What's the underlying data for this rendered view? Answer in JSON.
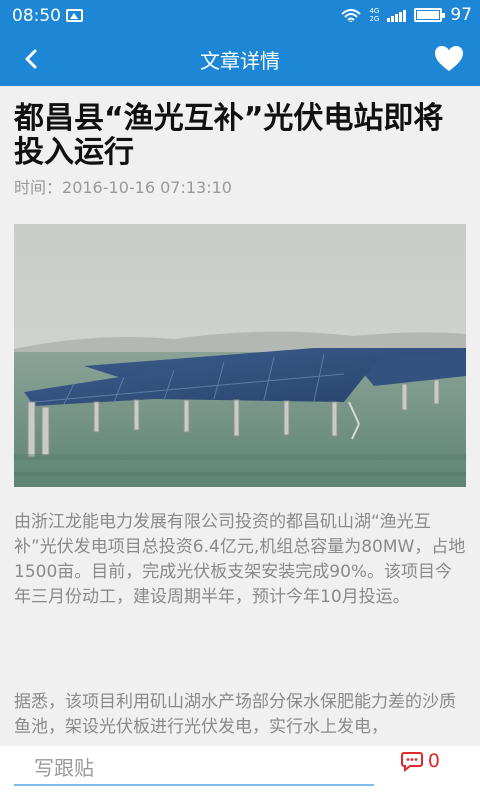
{
  "status_bar": {
    "time": "08:50",
    "network_top": "4G",
    "network_bottom": "2G",
    "battery": "97"
  },
  "header": {
    "title": "文章详情"
  },
  "article": {
    "title": "都昌县“渔光互补”光伏电站即将投入运行",
    "time_label": "时间：",
    "time_value": "2016-10-16 07:13:10",
    "paragraphs": [
      "由浙江龙能电力发展有限公司投资的都昌矶山湖“渔光互补”光伏发电项目总投资6.4亿元,机组总容量为80MW，占地1500亩。目前，完成光伏板支架安装完成90%。该项目今年三月份动工，建设周期半年，预计今年10月投运。",
      "据悉，该项目利用矶山湖水产场部分保水保肥能力差的沙质鱼池，架设光伏板进行光伏发电，实行水上发电，"
    ]
  },
  "bottom_bar": {
    "reply_placeholder": "写跟贴",
    "comment_count": "0"
  },
  "colors": {
    "brand_blue": "#1d87d6",
    "comment_red": "#e02828"
  },
  "icons": [
    "gallery-icon",
    "wifi-icon",
    "signal-icon",
    "battery-icon",
    "back-arrow-icon",
    "heart-icon",
    "comment-icon"
  ]
}
